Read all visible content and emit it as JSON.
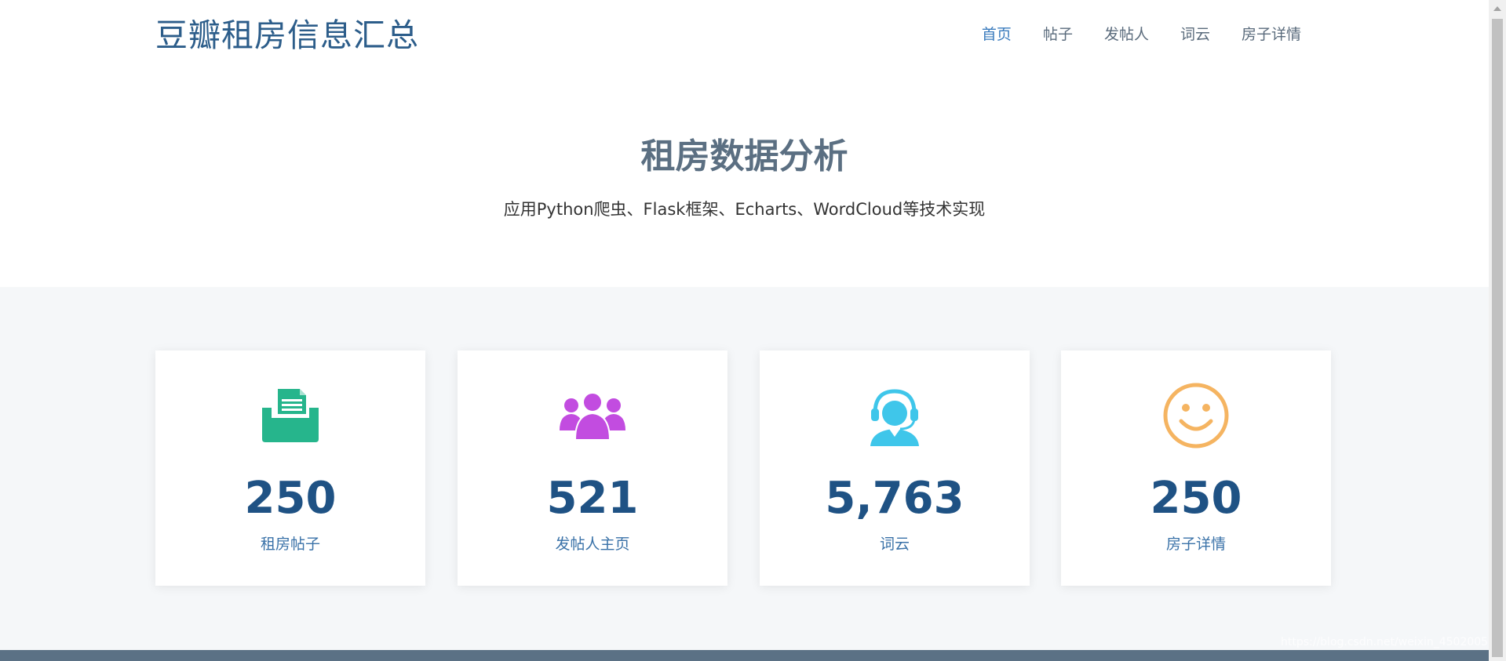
{
  "header": {
    "brand": "豆瓣租房信息汇总",
    "nav": [
      {
        "label": "首页",
        "active": true
      },
      {
        "label": "帖子",
        "active": false
      },
      {
        "label": "发帖人",
        "active": false
      },
      {
        "label": "词云",
        "active": false
      },
      {
        "label": "房子详情",
        "active": false
      }
    ]
  },
  "hero": {
    "title": "租房数据分析",
    "subtitle": "应用Python爬虫、Flask框架、Echarts、WordCloud等技术实现"
  },
  "stats": [
    {
      "icon": "folder-document-icon",
      "color": "#26b58c",
      "count": "250",
      "label": "租房帖子"
    },
    {
      "icon": "users-group-icon",
      "color": "#c24ce0",
      "count": "521",
      "label": "发帖人主页"
    },
    {
      "icon": "headset-agent-icon",
      "color": "#3fc6ea",
      "count": "5,763",
      "label": "词云"
    },
    {
      "icon": "smiley-face-icon",
      "color": "#f5b461",
      "count": "250",
      "label": "房子详情"
    }
  ],
  "watermark": "https://blog.csdn.net/weixin_45020055",
  "colors": {
    "brand": "#2c5d8a",
    "nav_active": "#3a7bbd",
    "count": "#1f5284",
    "label": "#3a72a8",
    "stats_bg": "#f5f7f9",
    "footer": "#5b7185"
  }
}
